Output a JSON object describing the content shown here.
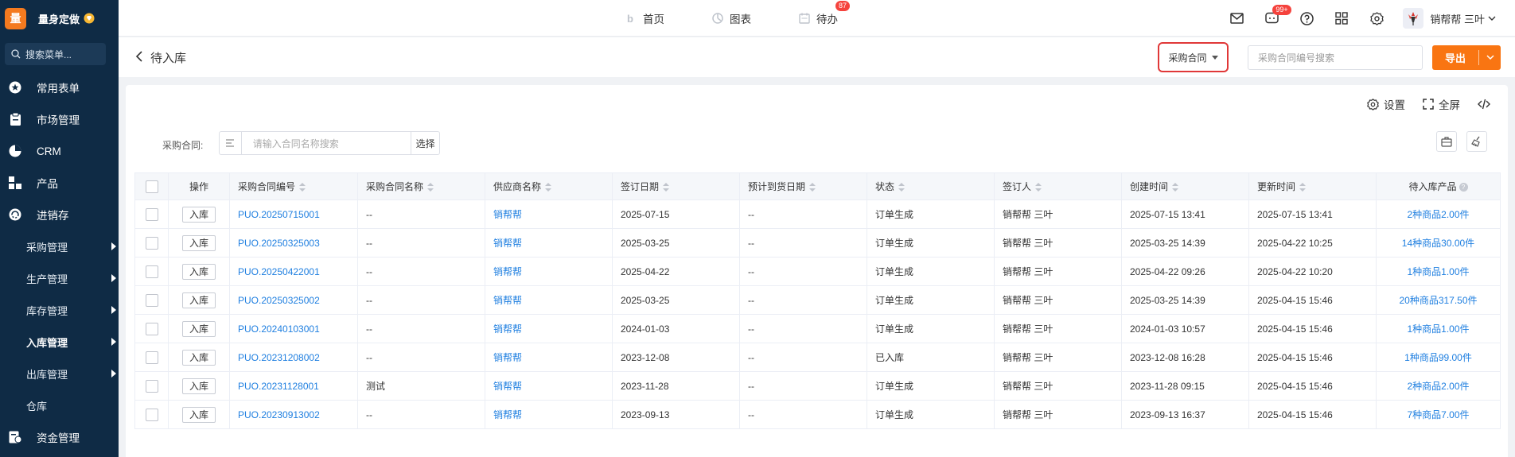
{
  "brand": {
    "logo_char": "量",
    "name": "量身定做"
  },
  "sidebar": {
    "search_placeholder": "搜索菜单...",
    "menu": [
      {
        "label": "常用表单",
        "icon": "star-icon"
      },
      {
        "label": "市场管理",
        "icon": "clipboard-icon"
      },
      {
        "label": "CRM",
        "icon": "pie-icon"
      },
      {
        "label": "产品",
        "icon": "blocks-icon"
      },
      {
        "label": "进销存",
        "icon": "cycle-icon"
      }
    ],
    "sub": [
      {
        "label": "采购管理"
      },
      {
        "label": "生产管理"
      },
      {
        "label": "库存管理"
      },
      {
        "label": "入库管理"
      },
      {
        "label": "出库管理"
      },
      {
        "label": "仓库"
      }
    ],
    "funds": {
      "label": "资金管理"
    }
  },
  "topbar": {
    "nav": [
      {
        "label": "首页"
      },
      {
        "label": "图表"
      },
      {
        "label": "待办",
        "badge": "87"
      }
    ],
    "message_badge": "99+",
    "user_name": "销帮帮 三叶"
  },
  "header": {
    "title": "待入库",
    "select_label": "采购合同",
    "search_placeholder": "采购合同编号搜索",
    "export_label": "导出"
  },
  "tools": {
    "settings": "设置",
    "fullscreen": "全屏"
  },
  "filter": {
    "label": "采购合同:",
    "placeholder": "请输入合同名称搜索",
    "choose": "选择"
  },
  "table": {
    "columns": [
      "操作",
      "采购合同编号",
      "采购合同名称",
      "供应商名称",
      "签订日期",
      "预计到货日期",
      "状态",
      "签订人",
      "创建时间",
      "更新时间",
      "待入库产品"
    ],
    "action_label": "入库",
    "rows": [
      {
        "code": "PUO.20250715001",
        "name": "--",
        "supplier": "销帮帮",
        "sign_date": "2025-07-15",
        "eta": "--",
        "status": "订单生成",
        "signer": "销帮帮 三叶",
        "created": "2025-07-15 13:41",
        "updated": "2025-07-15 13:41",
        "products": "2种商品2.00件"
      },
      {
        "code": "PUO.20250325003",
        "name": "--",
        "supplier": "销帮帮",
        "sign_date": "2025-03-25",
        "eta": "--",
        "status": "订单生成",
        "signer": "销帮帮 三叶",
        "created": "2025-03-25 14:39",
        "updated": "2025-04-22 10:25",
        "products": "14种商品30.00件"
      },
      {
        "code": "PUO.20250422001",
        "name": "--",
        "supplier": "销帮帮",
        "sign_date": "2025-04-22",
        "eta": "--",
        "status": "订单生成",
        "signer": "销帮帮 三叶",
        "created": "2025-04-22 09:26",
        "updated": "2025-04-22 10:20",
        "products": "1种商品1.00件"
      },
      {
        "code": "PUO.20250325002",
        "name": "--",
        "supplier": "销帮帮",
        "sign_date": "2025-03-25",
        "eta": "--",
        "status": "订单生成",
        "signer": "销帮帮 三叶",
        "created": "2025-03-25 14:39",
        "updated": "2025-04-15 15:46",
        "products": "20种商品317.50件"
      },
      {
        "code": "PUO.20240103001",
        "name": "--",
        "supplier": "销帮帮",
        "sign_date": "2024-01-03",
        "eta": "--",
        "status": "订单生成",
        "signer": "销帮帮 三叶",
        "created": "2024-01-03 10:57",
        "updated": "2025-04-15 15:46",
        "products": "1种商品1.00件"
      },
      {
        "code": "PUO.20231208002",
        "name": "--",
        "supplier": "销帮帮",
        "sign_date": "2023-12-08",
        "eta": "--",
        "status": "已入库",
        "signer": "销帮帮 三叶",
        "created": "2023-12-08 16:28",
        "updated": "2025-04-15 15:46",
        "products": "1种商品99.00件"
      },
      {
        "code": "PUO.20231128001",
        "name": "测试",
        "supplier": "销帮帮",
        "sign_date": "2023-11-28",
        "eta": "--",
        "status": "订单生成",
        "signer": "销帮帮 三叶",
        "created": "2023-11-28 09:15",
        "updated": "2025-04-15 15:46",
        "products": "2种商品2.00件"
      },
      {
        "code": "PUO.20230913002",
        "name": "--",
        "supplier": "销帮帮",
        "sign_date": "2023-09-13",
        "eta": "--",
        "status": "订单生成",
        "signer": "销帮帮 三叶",
        "created": "2023-09-13 16:37",
        "updated": "2025-04-15 15:46",
        "products": "7种商品7.00件"
      }
    ]
  }
}
